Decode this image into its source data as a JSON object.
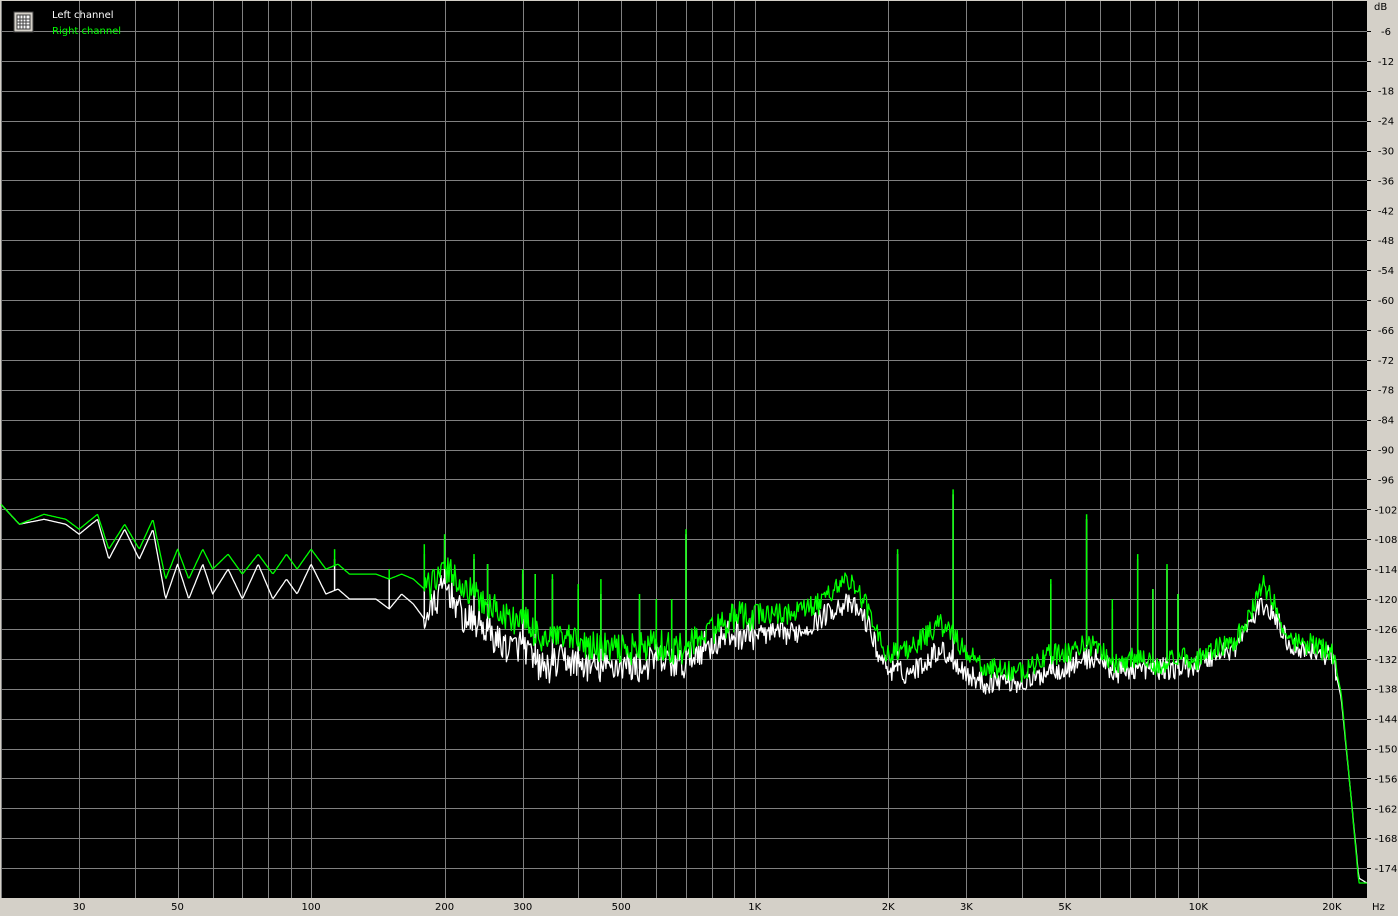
{
  "chart_data": {
    "type": "line",
    "title": "",
    "xlabel": "",
    "ylabel": "",
    "x_scale": "log",
    "xlim": [
      20,
      24000
    ],
    "ylim": [
      -180,
      0
    ],
    "grid": true,
    "legend_position": "top-left",
    "x_unit": "Hz",
    "y_unit": "dB",
    "x_ticks": [
      {
        "value": 30,
        "label": "30"
      },
      {
        "value": 50,
        "label": "50"
      },
      {
        "value": 100,
        "label": "100"
      },
      {
        "value": 200,
        "label": "200"
      },
      {
        "value": 300,
        "label": "300"
      },
      {
        "value": 500,
        "label": "500"
      },
      {
        "value": 1000,
        "label": "1K"
      },
      {
        "value": 2000,
        "label": "2K"
      },
      {
        "value": 3000,
        "label": "3K"
      },
      {
        "value": 5000,
        "label": "5K"
      },
      {
        "value": 10000,
        "label": "10K"
      },
      {
        "value": 20000,
        "label": "20K"
      }
    ],
    "y_ticks": [
      -6,
      -12,
      -18,
      -24,
      -30,
      -36,
      -42,
      -48,
      -54,
      -60,
      -66,
      -72,
      -78,
      -84,
      -90,
      -96,
      -102,
      -108,
      -114,
      -120,
      -126,
      -132,
      -138,
      -144,
      -150,
      -156,
      -162,
      -168,
      -174
    ],
    "colors": {
      "background": "#000000",
      "grid": "#808080",
      "frame": "#d4d0c8"
    },
    "series": [
      {
        "name": "Left channel",
        "color": "#ffffff",
        "points": [
          [
            20,
            -101
          ],
          [
            22,
            -105
          ],
          [
            25,
            -104
          ],
          [
            28,
            -105
          ],
          [
            30,
            -107
          ],
          [
            33,
            -104
          ],
          [
            35,
            -112
          ],
          [
            38,
            -106
          ],
          [
            41,
            -112
          ],
          [
            44,
            -106
          ],
          [
            47,
            -120
          ],
          [
            50,
            -113
          ],
          [
            53,
            -120
          ],
          [
            57,
            -113
          ],
          [
            60,
            -119
          ],
          [
            65,
            -114
          ],
          [
            70,
            -120
          ],
          [
            76,
            -113
          ],
          [
            82,
            -120
          ],
          [
            88,
            -116
          ],
          [
            93,
            -119
          ],
          [
            100,
            -113
          ],
          [
            108,
            -119
          ],
          [
            115,
            -118
          ],
          [
            122,
            -120
          ],
          [
            130,
            -120
          ],
          [
            140,
            -120
          ],
          [
            150,
            -122
          ],
          [
            160,
            -119
          ],
          [
            170,
            -121
          ],
          [
            180,
            -124
          ],
          [
            190,
            -121
          ],
          [
            200,
            -117
          ],
          [
            210,
            -120
          ],
          [
            220,
            -124
          ],
          [
            240,
            -125
          ],
          [
            260,
            -128
          ],
          [
            280,
            -130
          ],
          [
            300,
            -129
          ],
          [
            320,
            -133
          ],
          [
            340,
            -134
          ],
          [
            370,
            -132
          ],
          [
            400,
            -133
          ],
          [
            450,
            -134
          ],
          [
            500,
            -133
          ],
          [
            550,
            -134
          ],
          [
            600,
            -132
          ],
          [
            650,
            -133
          ],
          [
            700,
            -133
          ],
          [
            750,
            -130
          ],
          [
            800,
            -129
          ],
          [
            900,
            -127
          ],
          [
            1000,
            -127
          ],
          [
            1100,
            -127
          ],
          [
            1200,
            -127
          ],
          [
            1300,
            -126
          ],
          [
            1400,
            -124
          ],
          [
            1500,
            -122
          ],
          [
            1600,
            -121
          ],
          [
            1700,
            -122
          ],
          [
            1800,
            -125
          ],
          [
            1900,
            -131
          ],
          [
            2000,
            -134
          ],
          [
            2200,
            -135
          ],
          [
            2400,
            -133
          ],
          [
            2600,
            -130
          ],
          [
            2800,
            -132
          ],
          [
            3000,
            -135
          ],
          [
            3300,
            -137
          ],
          [
            3600,
            -136
          ],
          [
            4000,
            -137
          ],
          [
            4300,
            -136
          ],
          [
            4600,
            -134
          ],
          [
            5000,
            -134
          ],
          [
            5500,
            -132
          ],
          [
            6000,
            -132
          ],
          [
            6500,
            -135
          ],
          [
            7000,
            -134
          ],
          [
            7500,
            -134
          ],
          [
            8000,
            -134
          ],
          [
            9000,
            -134
          ],
          [
            10000,
            -133
          ],
          [
            11000,
            -131
          ],
          [
            12000,
            -130
          ],
          [
            13000,
            -125
          ],
          [
            14000,
            -121
          ],
          [
            15000,
            -124
          ],
          [
            16000,
            -129
          ],
          [
            17000,
            -130
          ],
          [
            18000,
            -130
          ],
          [
            19000,
            -131
          ],
          [
            20000,
            -131
          ],
          [
            21000,
            -140
          ],
          [
            22000,
            -158
          ],
          [
            23000,
            -176
          ],
          [
            24000,
            -177
          ]
        ]
      },
      {
        "name": "Right channel",
        "color": "#00ff00",
        "points": [
          [
            20,
            -101
          ],
          [
            22,
            -105
          ],
          [
            25,
            -103
          ],
          [
            28,
            -104
          ],
          [
            30,
            -106
          ],
          [
            33,
            -103
          ],
          [
            35,
            -110
          ],
          [
            38,
            -105
          ],
          [
            41,
            -110
          ],
          [
            44,
            -104
          ],
          [
            47,
            -116
          ],
          [
            50,
            -110
          ],
          [
            53,
            -116
          ],
          [
            57,
            -110
          ],
          [
            60,
            -114
          ],
          [
            65,
            -111
          ],
          [
            70,
            -115
          ],
          [
            76,
            -111
          ],
          [
            82,
            -115
          ],
          [
            88,
            -111
          ],
          [
            93,
            -114
          ],
          [
            100,
            -110
          ],
          [
            108,
            -114
          ],
          [
            115,
            -113
          ],
          [
            122,
            -115
          ],
          [
            130,
            -115
          ],
          [
            140,
            -115
          ],
          [
            150,
            -116
          ],
          [
            160,
            -115
          ],
          [
            170,
            -116
          ],
          [
            180,
            -118
          ],
          [
            190,
            -117
          ],
          [
            200,
            -114
          ],
          [
            210,
            -115
          ],
          [
            220,
            -118
          ],
          [
            240,
            -120
          ],
          [
            260,
            -122
          ],
          [
            280,
            -124
          ],
          [
            300,
            -124
          ],
          [
            320,
            -127
          ],
          [
            340,
            -128
          ],
          [
            370,
            -128
          ],
          [
            400,
            -129
          ],
          [
            450,
            -130
          ],
          [
            500,
            -130
          ],
          [
            550,
            -130
          ],
          [
            600,
            -129
          ],
          [
            650,
            -130
          ],
          [
            700,
            -130
          ],
          [
            750,
            -128
          ],
          [
            800,
            -126
          ],
          [
            900,
            -124
          ],
          [
            1000,
            -123
          ],
          [
            1100,
            -123
          ],
          [
            1200,
            -123
          ],
          [
            1300,
            -122
          ],
          [
            1400,
            -121
          ],
          [
            1500,
            -118
          ],
          [
            1600,
            -116
          ],
          [
            1700,
            -118
          ],
          [
            1800,
            -122
          ],
          [
            1900,
            -128
          ],
          [
            2000,
            -131
          ],
          [
            2200,
            -130
          ],
          [
            2400,
            -128
          ],
          [
            2600,
            -125
          ],
          [
            2800,
            -127
          ],
          [
            3000,
            -131
          ],
          [
            3300,
            -134
          ],
          [
            3600,
            -134
          ],
          [
            4000,
            -135
          ],
          [
            4300,
            -133
          ],
          [
            4600,
            -131
          ],
          [
            5000,
            -131
          ],
          [
            5500,
            -129
          ],
          [
            6000,
            -130
          ],
          [
            6500,
            -133
          ],
          [
            7000,
            -132
          ],
          [
            7500,
            -132
          ],
          [
            8000,
            -133
          ],
          [
            9000,
            -132
          ],
          [
            10000,
            -132
          ],
          [
            11000,
            -130
          ],
          [
            12000,
            -129
          ],
          [
            13000,
            -124
          ],
          [
            14000,
            -117
          ],
          [
            15000,
            -122
          ],
          [
            16000,
            -128
          ],
          [
            17000,
            -129
          ],
          [
            18000,
            -129
          ],
          [
            19000,
            -130
          ],
          [
            20000,
            -130
          ],
          [
            21000,
            -139
          ],
          [
            22000,
            -158
          ],
          [
            23000,
            -177
          ],
          [
            24000,
            -177
          ]
        ]
      }
    ],
    "spikes": [
      {
        "x": 113,
        "left": -112,
        "right": -110
      },
      {
        "x": 150,
        "left": -116,
        "right": -114
      },
      {
        "x": 180,
        "left": -111,
        "right": -109
      },
      {
        "x": 200,
        "left": -108,
        "right": -107
      },
      {
        "x": 233,
        "left": -112,
        "right": -111
      },
      {
        "x": 250,
        "left": -113,
        "right": -113
      },
      {
        "x": 300,
        "left": -115,
        "right": -114
      },
      {
        "x": 320,
        "left": -115,
        "right": -115
      },
      {
        "x": 350,
        "left": -116,
        "right": -115
      },
      {
        "x": 400,
        "left": -118,
        "right": -117
      },
      {
        "x": 450,
        "left": -119,
        "right": -116
      },
      {
        "x": 550,
        "left": -120,
        "right": -119
      },
      {
        "x": 600,
        "left": -120,
        "right": -120
      },
      {
        "x": 650,
        "left": -120,
        "right": -120
      },
      {
        "x": 700,
        "left": -107,
        "right": -106
      },
      {
        "x": 2100,
        "left": -111,
        "right": -110
      },
      {
        "x": 2800,
        "left": -99,
        "right": -98
      },
      {
        "x": 4650,
        "left": -117,
        "right": -116
      },
      {
        "x": 5600,
        "left": -104,
        "right": -103
      },
      {
        "x": 6400,
        "left": -122,
        "right": -120
      },
      {
        "x": 7300,
        "left": -112,
        "right": -111
      },
      {
        "x": 7900,
        "left": -118,
        "right": -118
      },
      {
        "x": 8500,
        "left": -114,
        "right": -113
      },
      {
        "x": 9000,
        "left": -119,
        "right": -119
      }
    ],
    "legend": {
      "entries": [
        {
          "label": "Left channel",
          "color": "#ffffff"
        },
        {
          "label": "Right channel",
          "color": "#00ff00"
        }
      ]
    }
  }
}
